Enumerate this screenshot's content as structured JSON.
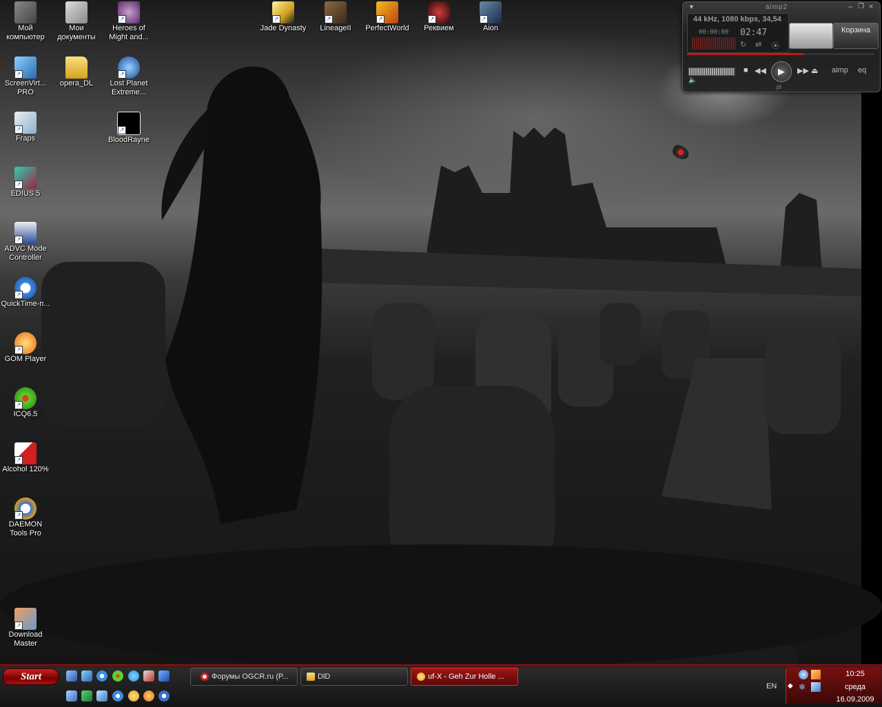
{
  "desktop": {
    "icons": [
      {
        "label": "Мой компьютер",
        "icon": "my-computer-icon",
        "color": "#666666"
      },
      {
        "label": "Мои документы",
        "icon": "my-documents-icon",
        "color": "#9a9a9a"
      },
      {
        "label": "Heroes of Might and...",
        "icon": "heroes-icon",
        "color": "#7a4a8a"
      },
      {
        "label": "ScreenVirt... PRO",
        "icon": "screenvirtuoso-icon",
        "color": "#3a8acf"
      },
      {
        "label": "opera_DL",
        "icon": "folder-icon",
        "color": "#e8c040"
      },
      {
        "label": "Lost Planet Extreme...",
        "icon": "lost-planet-icon",
        "color": "#3a6ab0"
      },
      {
        "label": "Fraps",
        "icon": "fraps-icon",
        "color": "#d8d800"
      },
      {
        "label": "BloodRayne",
        "icon": "bloodrayne-icon",
        "color": "#111111"
      },
      {
        "label": "EDIUS 5",
        "icon": "edius-icon",
        "color": "#1aa090"
      },
      {
        "label": "ADVC Mode Controller",
        "icon": "advc-icon",
        "color": "#2a4aa0"
      },
      {
        "label": "QuickTime-п...",
        "icon": "quicktime-icon",
        "color": "#3a8ae0"
      },
      {
        "label": "GOM Player",
        "icon": "gom-player-icon",
        "color": "#e88a10"
      },
      {
        "label": "ICQ6.5",
        "icon": "icq-icon",
        "color": "#40b020"
      },
      {
        "label": "Alcohol 120%",
        "icon": "alcohol-icon",
        "color": "#d02020"
      },
      {
        "label": "DAEMON Tools Pro",
        "icon": "daemon-tools-icon",
        "color": "#3a70d0"
      },
      {
        "label": "Download Master",
        "icon": "download-master-icon",
        "color": "#6a9ad0"
      },
      {
        "label": "Jade Dynasty",
        "icon": "jade-dynasty-icon",
        "color": "#d0a020"
      },
      {
        "label": "LineageII",
        "icon": "lineage-icon",
        "color": "#6a5030"
      },
      {
        "label": "PerfectWorld",
        "icon": "perfect-world-icon",
        "color": "#c04010"
      },
      {
        "label": "Реквием",
        "icon": "requiem-icon",
        "color": "#5a1010"
      },
      {
        "label": "Aion",
        "icon": "aion-icon",
        "color": "#2a3a5a"
      }
    ]
  },
  "aimp": {
    "title": "aimp2",
    "info": "44 kHz, 1080 kbps, 34,54",
    "time_small": "00:00:00",
    "time_big": "02:47",
    "basket_label": "Корзина",
    "pl_label": "pl",
    "brand": "aimp",
    "eq_label": "eq",
    "accent": "#c01818"
  },
  "taskbar": {
    "start_label": "Start",
    "quicklaunch": [
      {
        "icon": "show-desktop-icon",
        "color": "#4a7ad0"
      },
      {
        "icon": "screenvirtuoso-ql-icon",
        "color": "#3a8acf"
      },
      {
        "icon": "internet-explorer-icon",
        "color": "#3a90e0"
      },
      {
        "icon": "icq-ql-icon",
        "color": "#40b020"
      },
      {
        "icon": "skype-icon",
        "color": "#30a0e0"
      },
      {
        "icon": "camera-icon",
        "color": "#c03030"
      },
      {
        "icon": "maxthon-icon",
        "color": "#2a70d0"
      },
      {
        "icon": "ql-icon-8",
        "color": "#4a8ad0"
      },
      {
        "icon": "lineage-ql-icon",
        "color": "#30a050"
      },
      {
        "icon": "network-ql-icon",
        "color": "#4a90c0"
      },
      {
        "icon": "quicktime-ql-icon",
        "color": "#3a8ae0"
      },
      {
        "icon": "aimp-ql-icon",
        "color": "#e0a020"
      },
      {
        "icon": "gom-ql-icon",
        "color": "#e88a10"
      },
      {
        "icon": "media-ql-icon",
        "color": "#3a70d0"
      }
    ],
    "windows": [
      {
        "label": "Форумы OGCR.ru (Р...",
        "icon": "opera-icon",
        "color": "#d02020",
        "active": false
      },
      {
        "label": "DlD",
        "icon": "folder-icon",
        "color": "#e8c040",
        "active": false
      },
      {
        "label": "uf-X - Geh Zur Holle ...",
        "icon": "aimp-icon",
        "color": "#e0a020",
        "active": true
      }
    ],
    "lang": "EN",
    "clock_time": "10:25",
    "clock_day": "среда",
    "clock_date": "16.09.2009"
  }
}
